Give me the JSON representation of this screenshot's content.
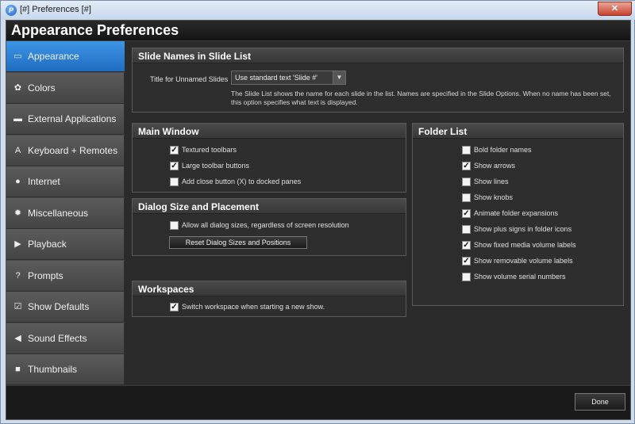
{
  "window": {
    "title": "[#] Preferences [#]",
    "app_icon_glyph": "P",
    "close_glyph": "✕"
  },
  "header": {
    "title": "Appearance Preferences"
  },
  "sidebar": {
    "items": [
      {
        "label": "Appearance",
        "icon": "appearance-icon",
        "glyph": "▭",
        "active": true
      },
      {
        "label": "Colors",
        "icon": "colors-icon",
        "glyph": "✿"
      },
      {
        "label": "External Applications",
        "icon": "external-applications-icon",
        "glyph": "▬"
      },
      {
        "label": "Keyboard + Remotes",
        "icon": "keyboard-icon",
        "glyph": "A"
      },
      {
        "label": "Internet",
        "icon": "globe-icon",
        "glyph": "●"
      },
      {
        "label": "Miscellaneous",
        "icon": "gear-icon",
        "glyph": "✹"
      },
      {
        "label": "Playback",
        "icon": "play-icon",
        "glyph": "▶"
      },
      {
        "label": "Prompts",
        "icon": "question-icon",
        "glyph": "?"
      },
      {
        "label": "Show Defaults",
        "icon": "checkbox-icon",
        "glyph": "☑"
      },
      {
        "label": "Sound Effects",
        "icon": "speaker-icon",
        "glyph": "◀"
      },
      {
        "label": "Thumbnails",
        "icon": "thumbnails-icon",
        "glyph": "■"
      }
    ]
  },
  "slide_names": {
    "heading": "Slide Names in Slide List",
    "field_label": "Title for Unnamed Slides",
    "select_value": "Use standard text 'Slide #'",
    "description": "The Slide List shows the name for each slide in the list. Names are specified in the Slide Options. When no name has been set, this option specifies what text is displayed."
  },
  "main_window": {
    "heading": "Main Window",
    "options": [
      {
        "label": "Textured toolbars",
        "checked": true
      },
      {
        "label": "Large toolbar buttons",
        "checked": true
      },
      {
        "label": "Add close button (X) to docked panes",
        "checked": false
      }
    ]
  },
  "dialog_size": {
    "heading": "Dialog Size and Placement",
    "option": {
      "label": "Allow all dialog sizes, regardless of screen resolution",
      "checked": false
    },
    "button_label": "Reset Dialog Sizes and Positions"
  },
  "workspaces": {
    "heading": "Workspaces",
    "option": {
      "label": "Switch workspace when starting a new show.",
      "checked": true
    }
  },
  "folder_list": {
    "heading": "Folder List",
    "options": [
      {
        "label": "Bold folder names",
        "checked": false
      },
      {
        "label": "Show arrows",
        "checked": true
      },
      {
        "label": "Show lines",
        "checked": false
      },
      {
        "label": "Show knobs",
        "checked": false
      },
      {
        "label": "Animate folder expansions",
        "checked": true
      },
      {
        "label": "Show plus signs in folder icons",
        "checked": false
      },
      {
        "label": "Show fixed media volume labels",
        "checked": true
      },
      {
        "label": "Show removable volume labels",
        "checked": true
      },
      {
        "label": "Show volume serial numbers",
        "checked": false
      }
    ]
  },
  "footer": {
    "done_label": "Done"
  },
  "colors": {
    "accent": "#2a7fd4",
    "panel_bg": "#2e2e2e",
    "window_bg": "#1e1e1e"
  },
  "check_glyph": "✓"
}
